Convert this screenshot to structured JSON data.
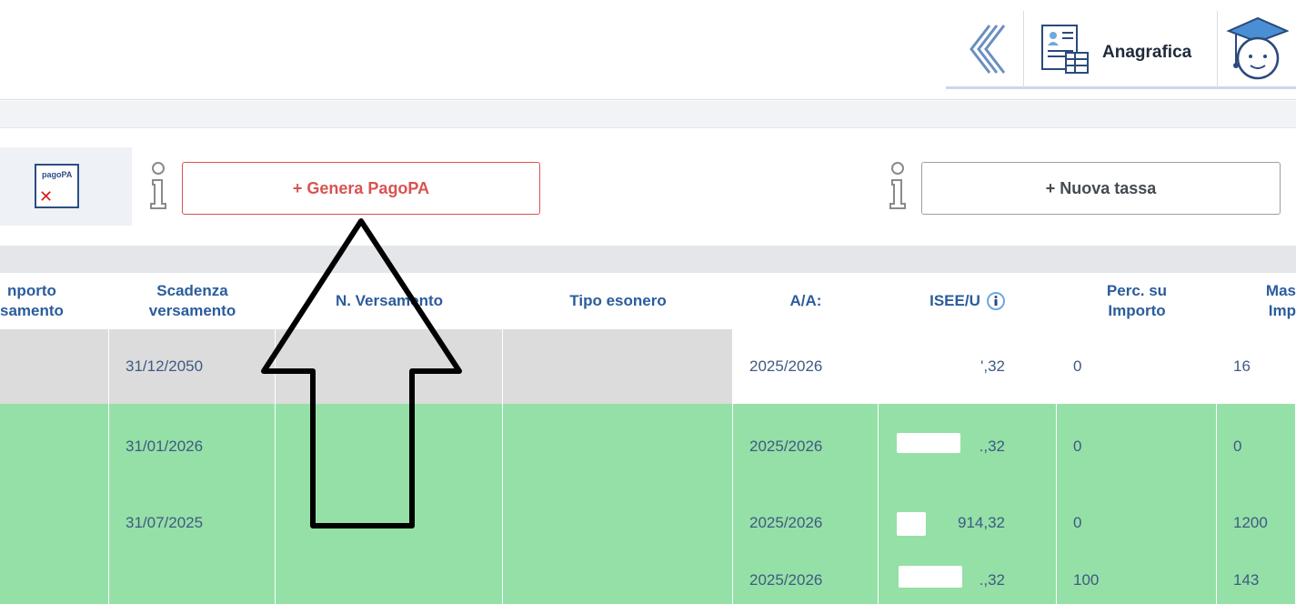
{
  "toolbar": {
    "back_icon": "double-chevron-left-icon",
    "anagrafica_label": "Anagrafica",
    "anagrafica_icon": "id-card-document-icon",
    "student_icon": "graduation-cap-student-icon"
  },
  "actions": {
    "pagopa_logo_text": "pagoPA",
    "genera_label": "+ Genera PagoPA",
    "nuova_label": "+ Nuova tassa",
    "info_icon": "info-icon"
  },
  "table": {
    "headers": [
      "nporto\nsamento",
      "Scadenza\nversamento",
      "N. Versamento",
      "Tipo esonero",
      "A/A:",
      "ISEE/U",
      "Perc. su\nImporto",
      "Mas\nImp"
    ],
    "rows": [
      {
        "scadenza": "31/12/2050",
        "aa": "2025/2026",
        "isee": "',32",
        "perc": "0",
        "mas": "16"
      },
      {
        "scadenza": "31/01/2026",
        "aa": "2025/2026",
        "isee": ".,32",
        "perc": "0",
        "mas": "0"
      },
      {
        "scadenza": "31/07/2025",
        "aa": "2025/2026",
        "isee": "914,32",
        "perc": "0",
        "mas": "1200"
      },
      {
        "scadenza": "",
        "aa": "2025/2026",
        "isee": ".,32",
        "perc": "100",
        "mas": "143"
      }
    ]
  },
  "colors": {
    "row_grey": "#dcdcdc",
    "row_green": "#95e0a6",
    "header_text": "#2b5c9c",
    "genera_red": "#d9534f"
  }
}
